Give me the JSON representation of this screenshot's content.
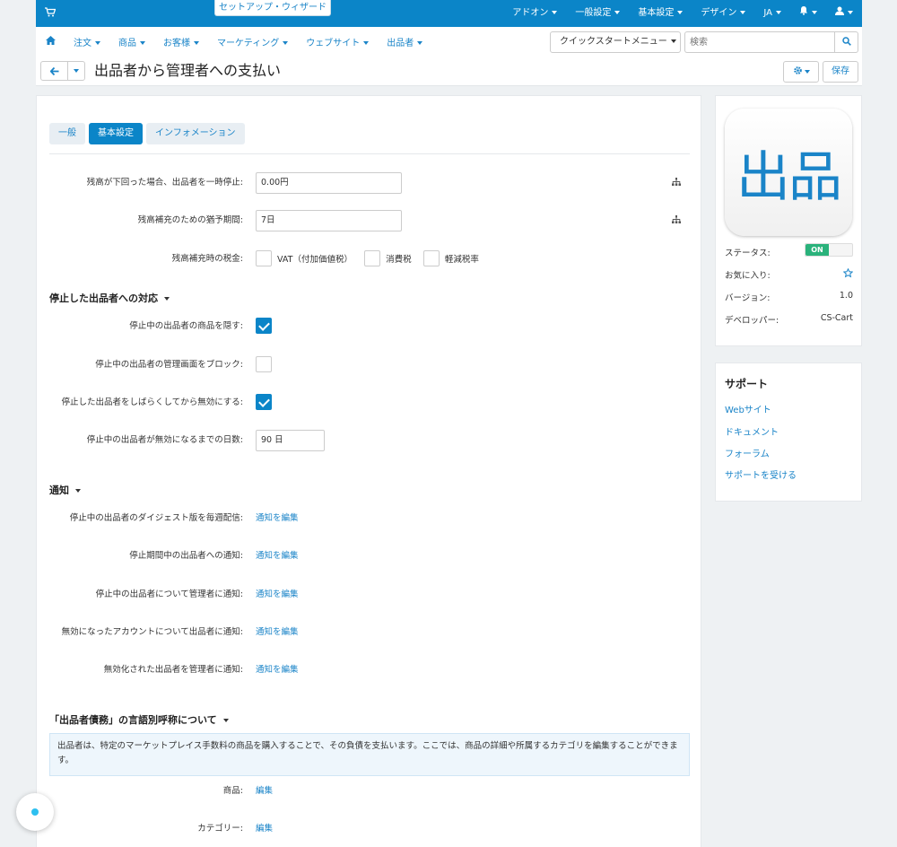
{
  "topbar": {
    "wizard": "セットアップ・ウィザード",
    "menu": [
      "アドオン",
      "一般設定",
      "基本設定",
      "デザイン",
      "JA"
    ]
  },
  "nav": {
    "items": [
      "注文",
      "商品",
      "お客様",
      "マーケティング",
      "ウェブサイト",
      "出品者"
    ],
    "quickstart": "クイックスタートメニュー",
    "search_placeholder": "検索"
  },
  "header": {
    "title": "出品者から管理者への支払い",
    "save": "保存"
  },
  "tabs": [
    {
      "label": "一般",
      "active": false
    },
    {
      "label": "基本設定",
      "active": true
    },
    {
      "label": "インフォメーション",
      "active": false
    }
  ],
  "settings": {
    "suspend_label": "残高が下回った場合、出品者を一時停止:",
    "suspend_value": "0.00円",
    "grace_label": "残高補充のための猶予期間:",
    "grace_value": "7日",
    "tax_label": "残高補充時の税金:",
    "taxes": [
      "VAT（付加価値税）",
      "消費税",
      "軽減税率"
    ]
  },
  "suspended": {
    "heading": "停止した出品者への対応",
    "hide_label": "停止中の出品者の商品を隠す:",
    "hide_checked": true,
    "block_label": "停止中の出品者の管理画面をブロック:",
    "block_checked": false,
    "disable_label": "停止した出品者をしばらくしてから無効にする:",
    "disable_checked": true,
    "days_label": "停止中の出品者が無効になるまでの日数:",
    "days_value": "90 日"
  },
  "notifications": {
    "heading": "通知",
    "edit": "通知を編集",
    "items": [
      "停止中の出品者のダイジェスト版を毎週配信:",
      "停止期間中の出品者への通知:",
      "停止中の出品者について管理者に通知:",
      "無効になったアカウントについて出品者に通知:",
      "無効化された出品者を管理者に通知:"
    ]
  },
  "debt": {
    "heading": "「出品者債務」の言語別呼称について",
    "info": "出品者は、特定のマーケットプレイス手数料の商品を購入することで、その負債を支払います。ここでは、商品の詳細や所属するカテゴリを編集することができます。",
    "edit": "編集",
    "product_label": "商品:",
    "category_label": "カテゴリー:"
  },
  "addon": {
    "logo_text": "出品",
    "status_label": "ステータス:",
    "status_value": "ON",
    "favorite_label": "お気に入り:",
    "version_label": "バージョン:",
    "version_value": "1.0",
    "developer_label": "デベロッパー:",
    "developer_value": "CS-Cart"
  },
  "support": {
    "heading": "サポート",
    "links": [
      "Webサイト",
      "ドキュメント",
      "フォーラム",
      "サポートを受ける"
    ]
  },
  "colors": {
    "primary": "#0b85c8",
    "status_on": "#2ab27b"
  }
}
